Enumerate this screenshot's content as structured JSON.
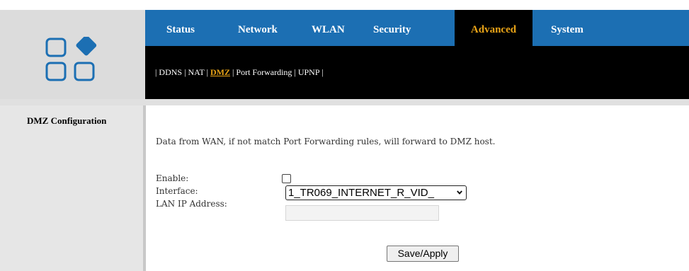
{
  "nav": {
    "tabs": [
      {
        "label": "Status"
      },
      {
        "label": "Network"
      },
      {
        "label": "WLAN"
      },
      {
        "label": "Security"
      },
      {
        "label": "Advanced",
        "active": true
      },
      {
        "label": "System"
      }
    ]
  },
  "subnav": {
    "sep": "|",
    "items": [
      {
        "label": "DDNS"
      },
      {
        "label": "NAT"
      },
      {
        "label": "DMZ",
        "active": true
      },
      {
        "label": "Port Forwarding"
      },
      {
        "label": "UPNP"
      }
    ]
  },
  "sidebar": {
    "title": "DMZ Configuration"
  },
  "form": {
    "description": "Data from WAN, if not match Port Forwarding rules, will forward to DMZ host.",
    "enable_label": "Enable:",
    "enable_checked": false,
    "interface_label": "Interface:",
    "interface_value": "1_TR069_INTERNET_R_VID_",
    "lan_ip_label": "LAN IP Address:",
    "lan_ip_value": "",
    "apply_label": "Save/Apply"
  },
  "colors": {
    "nav_bg": "#1c6fb3",
    "subnav_bg": "#000000",
    "active_text": "#e8a317",
    "logo_blue": "#1c6fb3"
  },
  "icons": {
    "logo": "logo-icon",
    "dropdown": "chevron-down-icon"
  }
}
